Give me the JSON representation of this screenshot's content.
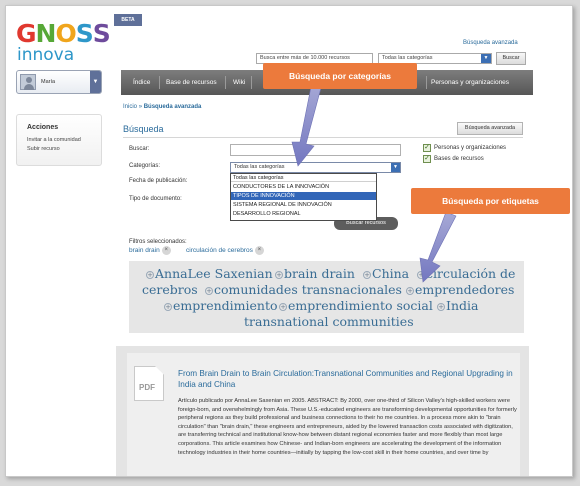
{
  "brand": {
    "logo_top": "GNOSS",
    "logo_bottom": "innova",
    "beta": "BETA"
  },
  "header": {
    "advanced_link": "Búsqueda avanzada",
    "search_placeholder": "Busca entre más de 10.000 recursos",
    "category_value": "Todas las categorías",
    "search_button": "Buscar"
  },
  "user": {
    "name": "María"
  },
  "nav": {
    "items": [
      {
        "label": "Índice"
      },
      {
        "label": "Base de recursos"
      },
      {
        "label": "Wiki"
      },
      {
        "label": "Personas y organizaciones"
      }
    ]
  },
  "sidebar": {
    "title": "Acciones",
    "links": [
      {
        "label": "Invitar a la comunidad"
      },
      {
        "label": "Subir recurso"
      }
    ]
  },
  "breadcrumb": {
    "home": "Inicio",
    "sep": "»",
    "current": "Búsqueda avanzada"
  },
  "search_form": {
    "title": "Búsqueda",
    "advanced_button": "Búsqueda avanzada",
    "buscar_label": "Buscar:",
    "buscar_value": "",
    "categorias_label": "Categorías:",
    "categorias_value": "Todas las categorías",
    "fecha_label": "Fecha de publicación:",
    "tipo_label": "Tipo de documento:",
    "dropdown_options": [
      {
        "label": "Todas las categorías",
        "selected": false
      },
      {
        "label": "CONDUCTORES DE LA INNOVACIÓN",
        "selected": false
      },
      {
        "label": "TIPOS DE INNOVACIÓN",
        "selected": true
      },
      {
        "label": "SISTEMA REGIONAL DE INNOVACIÓN",
        "selected": false
      },
      {
        "label": "DESARROLLO REGIONAL",
        "selected": false
      }
    ],
    "checkboxes": [
      {
        "label": "Personas y organizaciones",
        "checked": true
      },
      {
        "label": "Bases de recursos",
        "checked": true
      }
    ],
    "submit_label": "Buscar recursos"
  },
  "filters": {
    "title": "Filtros seleccionados:",
    "items": [
      {
        "label": "brain drain"
      },
      {
        "label": "circulación de cerebros"
      }
    ],
    "remove_glyph": "×"
  },
  "tagcloud": {
    "tags": [
      {
        "label": "AnnaLee Saxenian"
      },
      {
        "label": "brain drain"
      },
      {
        "label": "China"
      },
      {
        "label": "circulación de"
      },
      {
        "label": "cerebros"
      },
      {
        "label": "comunidades transnacionales"
      },
      {
        "label": "emprendedores"
      },
      {
        "label": "emprendimiento"
      },
      {
        "label": "emprendimiento social"
      },
      {
        "label": "India"
      },
      {
        "label": "transnational communities"
      }
    ],
    "plus_glyph": "+"
  },
  "result": {
    "file_type": "PDF",
    "title": "From Brain Drain to Brain Circulation:Transnational Communities and Regional Upgrading in India and China",
    "body": "Artículo publicado por AnnaLee Saxenian en 2005. ABSTRACT: By 2000, over one-third of Silicon Valley's high-skilled workers were foreign-born, and overwhelmingly from Asia. These U.S.-educated engineers are transforming developmental opportunities for formerly peripheral regions as they build professional and business connections to their ho me countries. In a process more akin to \"brain circulation\" than \"brain drain,\" these engineers and entrepreneurs, aided by the lowered transaction costs associated with digitization, are transferring technical and institutional know-how between distant regional economies faster and more flexibly than most large corporations. This article examines how Chinese- and Indian-born engineers are accelerating the development of the information technology industries in their home countries—initially by tapping the low-cost skill in their home countries, and over time by"
  },
  "annotations": {
    "callout_categories": "Búsqueda por categorías",
    "callout_tags": "Búsqueda por etiquetas"
  },
  "colors": {
    "accent": "#2a6b9b",
    "callout": "#ec7a3c",
    "nav": "#5f5f5f",
    "selected_option": "#3266b8"
  }
}
